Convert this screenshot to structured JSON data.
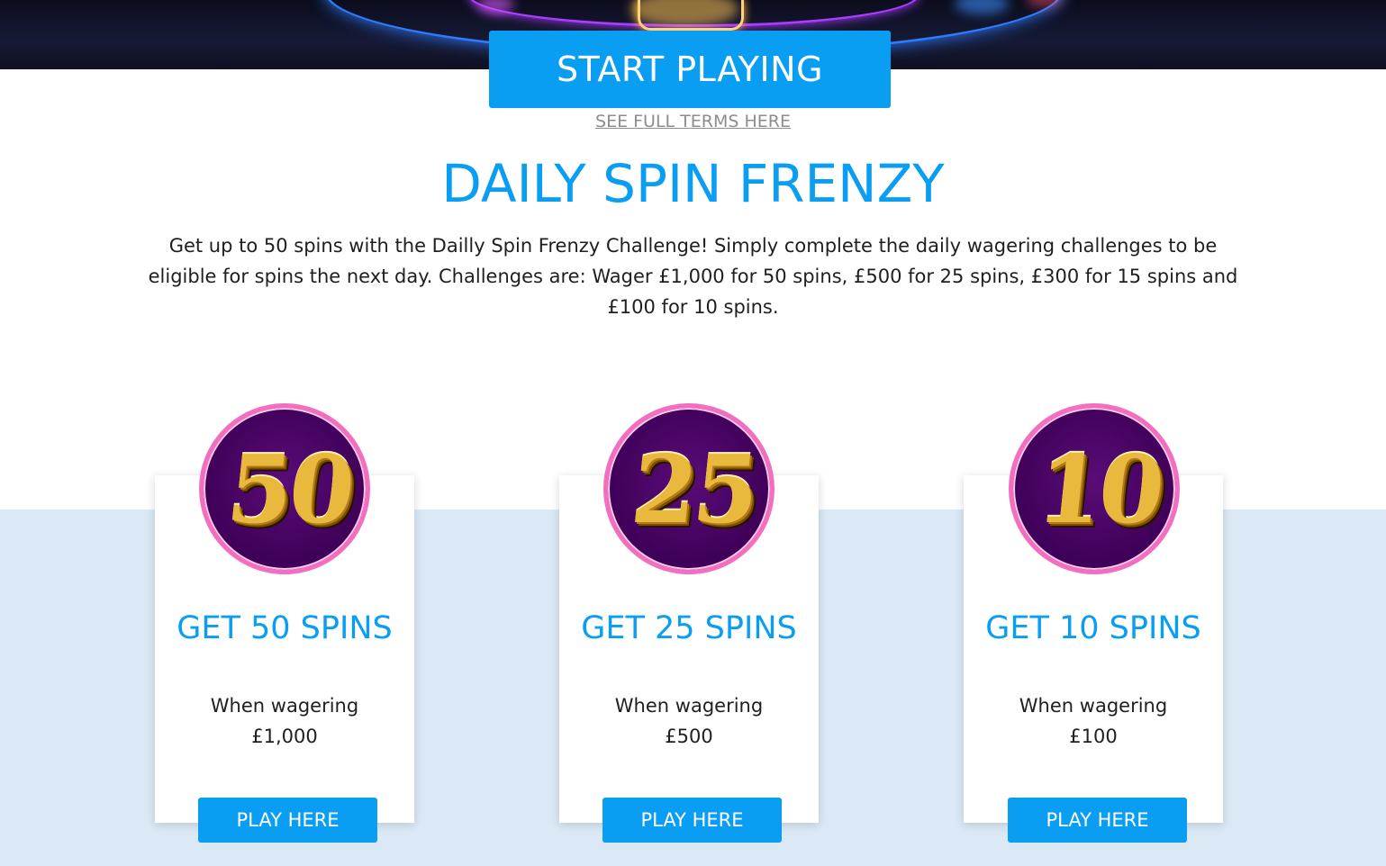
{
  "hero": {
    "cta_label": "START PLAYING",
    "terms_link": "SEE FULL TERMS HERE"
  },
  "promo": {
    "title": "DAILY SPIN FRENZY",
    "description_lines": [
      "Get up to 50 spins with the Dailly Spin Frenzy Challenge! Simply complete the daily wagering challenges to be",
      "eligible for spins the next day. Challenges are: Wager £1,000 for 50 spins, £500 for 25 spins, £300 for 15 spins and",
      "£100 for 10 spins."
    ]
  },
  "cards": [
    {
      "badge_number": "50",
      "title": "GET 50 SPINS",
      "line1": "When wagering",
      "line2": "£1,000",
      "button": "PLAY HERE"
    },
    {
      "badge_number": "25",
      "title": "GET 25 SPINS",
      "line1": "When wagering",
      "line2": "£500",
      "button": "PLAY HERE"
    },
    {
      "badge_number": "10",
      "title": "GET 10 SPINS",
      "line1": "When wagering",
      "line2": "£100",
      "button": "PLAY HERE"
    }
  ],
  "colors": {
    "accent": "#0a9ef2",
    "band_background": "#dbe9f6",
    "badge_purple": "#4a066a",
    "badge_ring": "#f26fc0",
    "gold": "#e9b93e"
  }
}
